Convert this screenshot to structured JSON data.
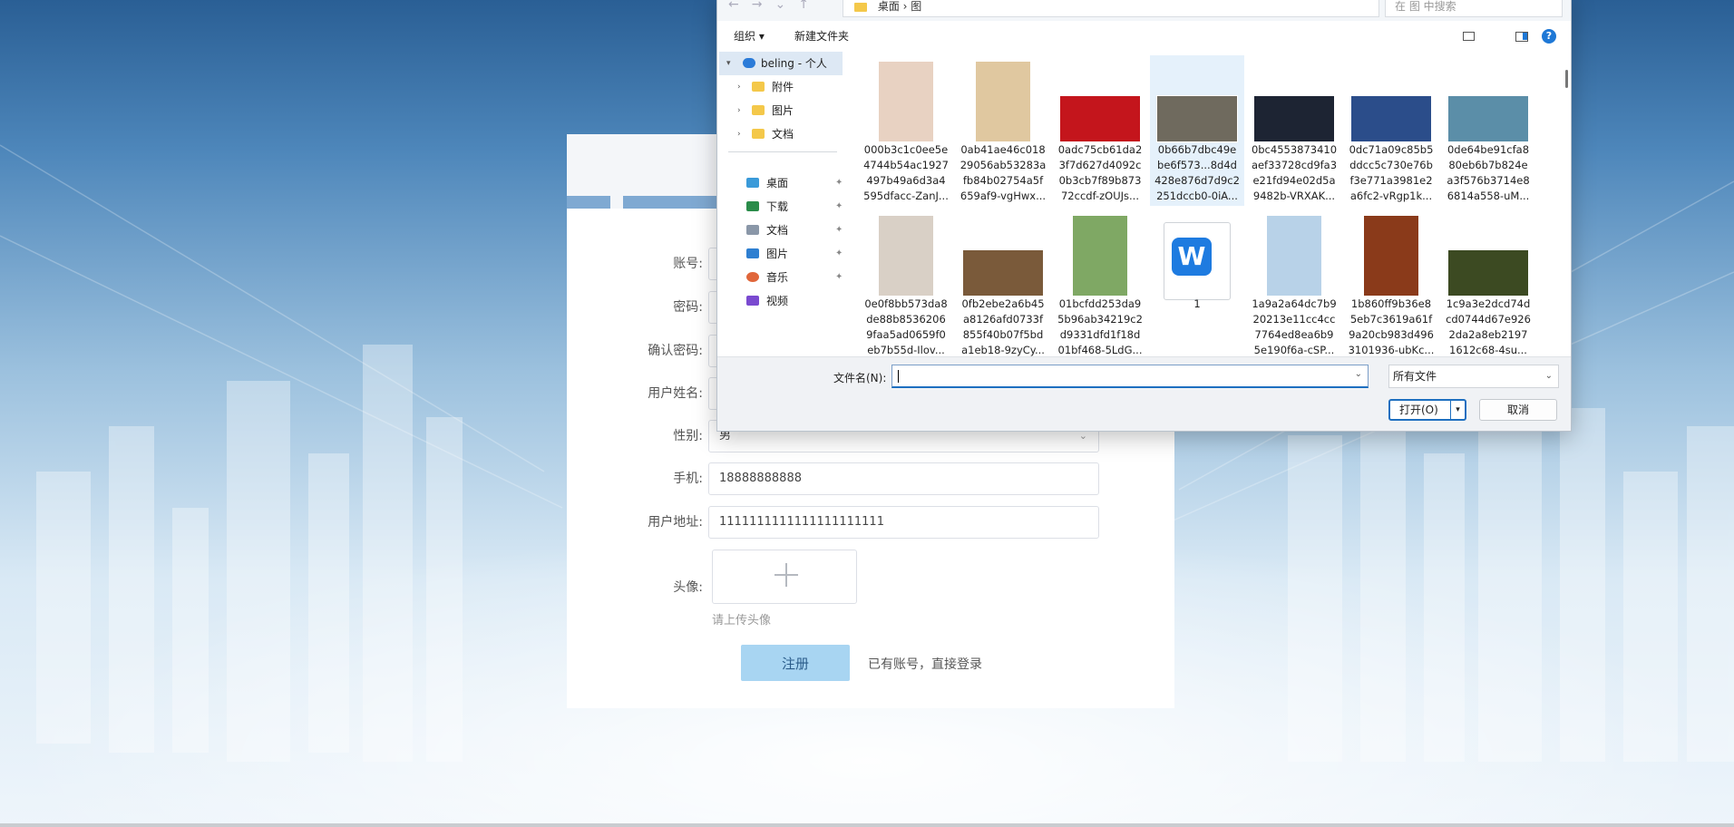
{
  "register": {
    "labels": {
      "account": "账号:",
      "password": "密码:",
      "confirm_password": "确认密码:",
      "real_name": "用户姓名:",
      "gender": "性别:",
      "phone": "手机:",
      "address": "用户地址:",
      "avatar": "头像:"
    },
    "values": {
      "gender": "男",
      "phone": "18888888888",
      "address": "1111111111111111111111"
    },
    "upload_hint": "请上传头像",
    "register_button": "注册",
    "login_link": "已有账号，直接登录"
  },
  "dialog": {
    "address_path": [
      "桌面",
      "图"
    ],
    "search_placeholder": "在 图 中搜索",
    "toolbar": {
      "organize": "组织 ▾",
      "new_folder": "新建文件夹"
    },
    "tree": {
      "root": "beling - 个人",
      "folders": [
        "附件",
        "图片",
        "文档"
      ],
      "quick": [
        "桌面",
        "下载",
        "文档",
        "图片",
        "音乐",
        "视频"
      ]
    },
    "files": [
      {
        "name": "000b3c1c0ee5e\n4744b54ac1927\n497b49a6d3a4\n595dfacc-ZanJ...",
        "color": "#e8d2c2",
        "shape": "tall"
      },
      {
        "name": "0ab41ae46c018\n29056ab53283a\nfb84b02754a5f\n659af9-vgHwx...",
        "color": "#e0c8a0",
        "shape": "tall"
      },
      {
        "name": "0adc75cb61da2\n3f7d627d4092c\n0b3cb7f89b873\n72ccdf-zOUJs...",
        "color": "#c4151c",
        "shape": "wide"
      },
      {
        "name": "0b66b7dbc49e\nbe6f573...8d4d\n428e876d7d9c2\n251dccb0-0iA...",
        "color": "#6f6a5e",
        "shape": "wide"
      },
      {
        "name": "0bc4553873410\naef33728cd9fa3\ne21fd94e02d5a\n9482b-VRXAK...",
        "color": "#1d2433",
        "shape": "wide"
      },
      {
        "name": "0dc71a09c85b5\nddcc5c730e76b\nf3e771a3981e2\na6fc2-vRgp1k...",
        "color": "#2b4d8a",
        "shape": "wide"
      },
      {
        "name": "0de64be91cfa8\n80eb6b7b824e\na3f576b3714e8\n6814a558-uM...",
        "color": "#5b8ea8",
        "shape": "wide"
      },
      {
        "name": "0e0f8bb573da8\nde88b8536206\n9faa5ad0659f0\neb7b55d-Ilov...",
        "color": "#d9d0c6",
        "shape": "tall"
      },
      {
        "name": "0fb2ebe2a6b45\na8126afd0733f\n855f40b07f5bd\na1eb18-9zyCy...",
        "color": "#7a5a3a",
        "shape": "wide"
      },
      {
        "name": "01bcfdd253da9\n5b96ab34219c2\nd9331dfd1f18d\n01bf468-5LdG...",
        "color": "#7fa864",
        "shape": "tall"
      },
      {
        "name": "1",
        "color": "#1e7be0",
        "shape": "doc"
      },
      {
        "name": "1a9a2a64dc7b9\n20213e11cc4cc\n7764ed8ea6b9\n5e190f6a-cSP...",
        "color": "#b8d2e8",
        "shape": "tall"
      },
      {
        "name": "1b860ff9b36e8\n5eb7c3619a61f\n9a20cb983d496\n3101936-ubKc...",
        "color": "#8a3a1a",
        "shape": "tall"
      },
      {
        "name": "1c9a3e2dcd74d\ncd0744d67e926\n2da2a8eb2197\n1612c68-4su...",
        "color": "#3c4a22",
        "shape": "wide"
      }
    ],
    "filename_label": "文件名(N):",
    "filename_value": "",
    "filetype": "所有文件",
    "open_button": "打开(O)",
    "cancel_button": "取消"
  }
}
